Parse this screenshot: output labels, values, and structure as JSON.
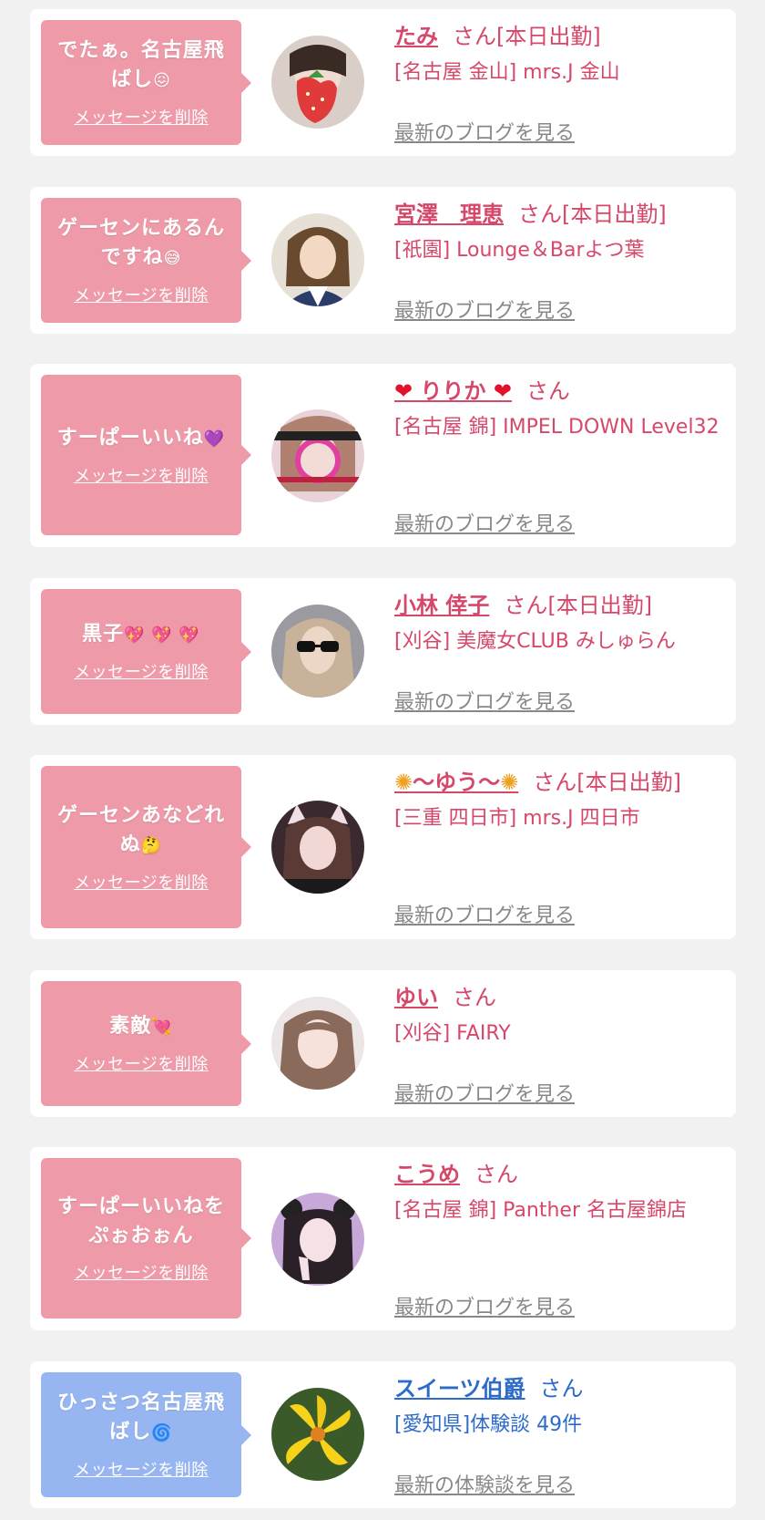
{
  "delete_label": "メッセージを削除",
  "san": "さん",
  "colors": {
    "pink_bubble": "#ee9aa8",
    "blue_bubble": "#97b6f1",
    "pink_text": "#d6486a",
    "blue_text": "#2d6bc9",
    "link_gray": "#888888"
  },
  "cards": [
    {
      "msg": "でたぁ。名古屋飛ばし",
      "msg_emoji": "😖",
      "name": "たみ",
      "status": "[本日出勤]",
      "shop": "[名古屋 金山] mrs.J 金山",
      "link": "最新のブログを見る",
      "avatar_icon": "strawberry"
    },
    {
      "msg": "ゲーセンにあるんですね",
      "msg_emoji": "😅",
      "name": "宮澤　理恵",
      "status": "[本日出勤]",
      "shop": "[祇園] Lounge＆Barよつ葉",
      "link": "最新のブログを見る",
      "avatar_icon": "woman"
    },
    {
      "msg": "すーぱーいいね",
      "msg_emoji": "💜",
      "name_prefix": "❤",
      "name": "りりか",
      "name_suffix": "❤",
      "status": "",
      "shop": "[名古屋 錦] IMPEL DOWN Level32",
      "link": "最新のブログを見る",
      "avatar_icon": "stamp"
    },
    {
      "msg": "黒子",
      "msg_emoji": "💖 💖 💖",
      "name": "小林 倖子",
      "status": "[本日出勤]",
      "shop": "[刈谷] 美魔女CLUB みしゅらん",
      "link": "最新のブログを見る",
      "avatar_icon": "sunglasses"
    },
    {
      "msg": "ゲーセンあなどれぬ",
      "msg_emoji": "🤔",
      "name_prefix": "✺",
      "name": "〜ゆう〜",
      "name_suffix": "✺",
      "status": "[本日出勤]",
      "shop": "[三重 四日市] mrs.J 四日市",
      "link": "最新のブログを見る",
      "avatar_icon": "catgirl"
    },
    {
      "msg": "素敵",
      "msg_emoji": "💘",
      "name": "ゆい",
      "status": "",
      "shop": "[刈谷] FAIRY",
      "link": "最新のブログを見る",
      "avatar_icon": "girl"
    },
    {
      "msg": "すーぱーいいねをぷぉおぉん",
      "msg_emoji": "",
      "name": "こうめ",
      "status": "",
      "shop": "[名古屋 錦] Panther 名古屋錦店",
      "link": "最新のブログを見る",
      "avatar_icon": "peace"
    },
    {
      "msg": "ひっさつ名古屋飛ばし",
      "msg_emoji": "🌀",
      "name": "スイーツ伯爵",
      "status": "",
      "shop": "[愛知県]体験談 49件",
      "link": "最新の体験談を見る",
      "avatar_icon": "flower"
    }
  ]
}
